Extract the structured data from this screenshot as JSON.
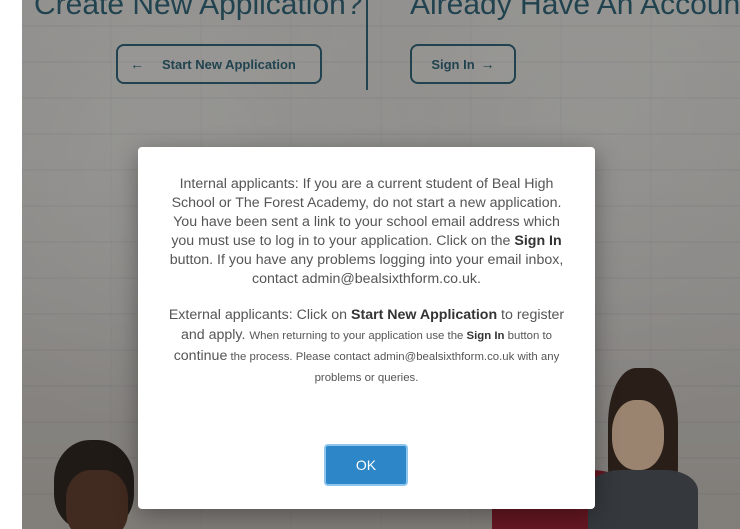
{
  "headings": {
    "left": "Create New Application?",
    "right": "Already Have An Account?"
  },
  "buttons": {
    "start_arrow": "←",
    "start_label": "Start New Application",
    "signin_label": "Sign In",
    "signin_arrow": "→"
  },
  "modal": {
    "p1_a": "Internal applicants: If you are a current student of Beal High School or The Forest Academy, do not start a new application. You have been sent a link to your school email address which you must use to log in to your application. Click on the ",
    "p1_bold": "Sign In",
    "p1_b": " button. If you have any problems logging into your email inbox, contact admin@bealsixthform.co.uk.",
    "p2_a": "External applicants: Click on ",
    "p2_bold1": "Start New Application",
    "p2_b": " to register and apply. ",
    "p2_small1": "When returning to your application use the ",
    "p2_bold2": "Sign In",
    "p2_small2": " button to ",
    "p2_continue": "continue",
    "p2_small3": " the process. Please contact admin@bealsixthform.co.uk with any problems or queries.",
    "ok_label": "OK"
  }
}
